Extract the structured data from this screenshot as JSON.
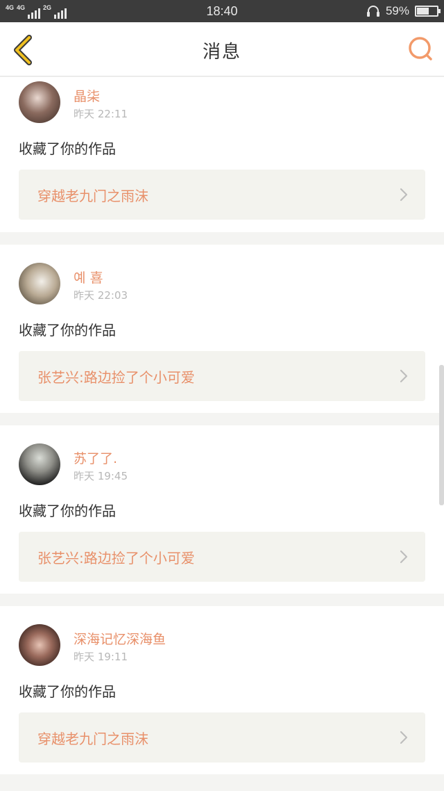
{
  "status_bar": {
    "network_1": "4G",
    "network_2": "4G",
    "network_3": "2G",
    "time": "18:40",
    "battery_percent": "59%",
    "battery_level": 0.59
  },
  "header": {
    "title": "消息",
    "back_icon": "chevron-left-icon",
    "search_icon": "search-icon"
  },
  "messages": [
    {
      "username": "晶柒",
      "time": "昨天 22:11",
      "action": "收藏了你的作品",
      "work_title": "穿越老九门之雨沫"
    },
    {
      "username": "예 喜",
      "time": "昨天 22:03",
      "action": "收藏了你的作品",
      "work_title": "张艺兴:路边捡了个小可爱"
    },
    {
      "username": "苏了了.",
      "time": "昨天 19:45",
      "action": "收藏了你的作品",
      "work_title": "张艺兴:路边捡了个小可爱"
    },
    {
      "username": "深海记忆深海鱼",
      "time": "昨天 19:11",
      "action": "收藏了你的作品",
      "work_title": "穿越老九门之雨沫"
    }
  ],
  "colors": {
    "accent": "#e8906a",
    "back_icon": "#f0c020",
    "card_bg": "#ffffff",
    "page_bg": "#f4f4f2",
    "work_bg": "#f3f3ee"
  }
}
